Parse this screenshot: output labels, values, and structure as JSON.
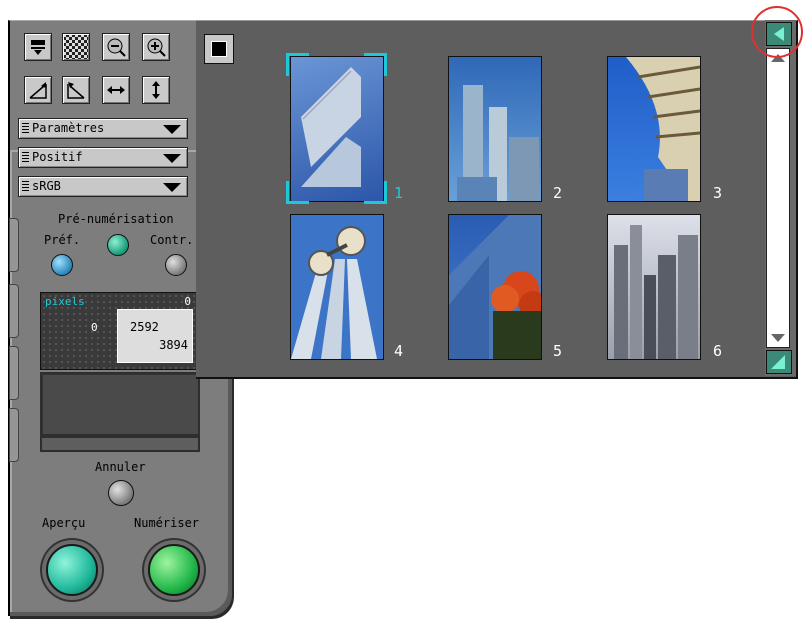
{
  "toolbar": {
    "row1": [
      "scan-icon",
      "checker-icon",
      "zoom-out-icon",
      "zoom-in-icon"
    ],
    "row2": [
      "rotate-right-icon",
      "rotate-left-icon",
      "flip-horizontal-icon",
      "flip-vertical-icon"
    ]
  },
  "dropdowns": {
    "settings": "Paramètres",
    "film_type": "Positif",
    "color_space": "sRGB"
  },
  "prescan": {
    "title": "Pré-numérisation",
    "pref_label": "Préf.",
    "contr_label": "Contr."
  },
  "pixels": {
    "label": "pixels",
    "top_value": "0",
    "left_value": "0",
    "width": "2592",
    "height": "3894"
  },
  "buttons": {
    "cancel": "Annuler",
    "preview": "Aperçu",
    "scan": "Numériser"
  },
  "thumbnails": [
    {
      "number": "1",
      "selected": true
    },
    {
      "number": "2",
      "selected": false
    },
    {
      "number": "3",
      "selected": false
    },
    {
      "number": "4",
      "selected": false
    },
    {
      "number": "5",
      "selected": false
    },
    {
      "number": "6",
      "selected": false
    }
  ],
  "colors": {
    "accent": "#1ec8d8",
    "preview_button": "#1fb89a",
    "scan_button": "#22b84a",
    "highlight_circle": "#e03030"
  }
}
